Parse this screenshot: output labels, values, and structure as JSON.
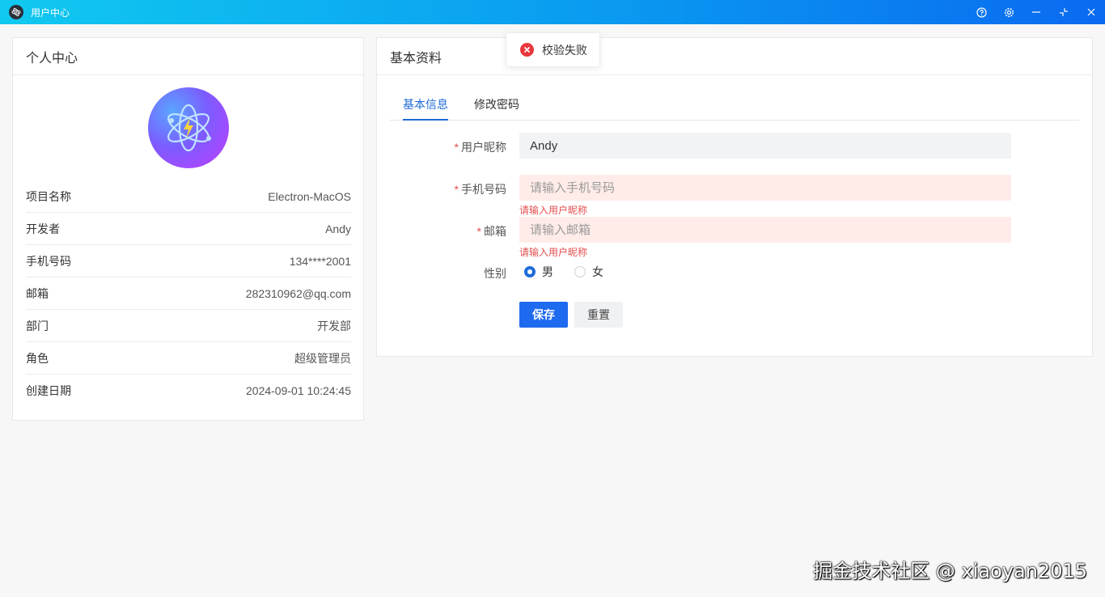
{
  "window": {
    "title": "用户中心",
    "controls": [
      "help-icon",
      "gear-icon",
      "minimize-icon",
      "restore-icon",
      "close-icon"
    ]
  },
  "profile_card": {
    "title": "个人中心",
    "rows": [
      {
        "label": "项目名称",
        "value": "Electron-MacOS"
      },
      {
        "label": "开发者",
        "value": "Andy"
      },
      {
        "label": "手机号码",
        "value": "134****2001"
      },
      {
        "label": "邮箱",
        "value": "282310962@qq.com"
      },
      {
        "label": "部门",
        "value": "开发部"
      },
      {
        "label": "角色",
        "value": "超级管理员"
      },
      {
        "label": "创建日期",
        "value": "2024-09-01 10:24:45"
      }
    ]
  },
  "settings_card": {
    "title": "基本资料",
    "tabs": [
      {
        "label": "基本信息",
        "active": true
      },
      {
        "label": "修改密码",
        "active": false
      }
    ],
    "form": {
      "nickname": {
        "label": "用户昵称",
        "value": "Andy"
      },
      "phone": {
        "label": "手机号码",
        "placeholder": "请输入手机号码",
        "error": "请输入用户昵称"
      },
      "email": {
        "label": "邮箱",
        "placeholder": "请输入邮箱",
        "error": "请输入用户昵称"
      },
      "gender": {
        "label": "性别",
        "options": [
          "男",
          "女"
        ],
        "selected": "男"
      },
      "save_label": "保存",
      "reset_label": "重置"
    }
  },
  "toast": {
    "message": "校验失败"
  },
  "watermark": "掘金技术社区 @ xiaoyan2015",
  "colors": {
    "primary": "#1f6bf0",
    "error": "#e34d4d",
    "error_bg": "#ffece8"
  }
}
